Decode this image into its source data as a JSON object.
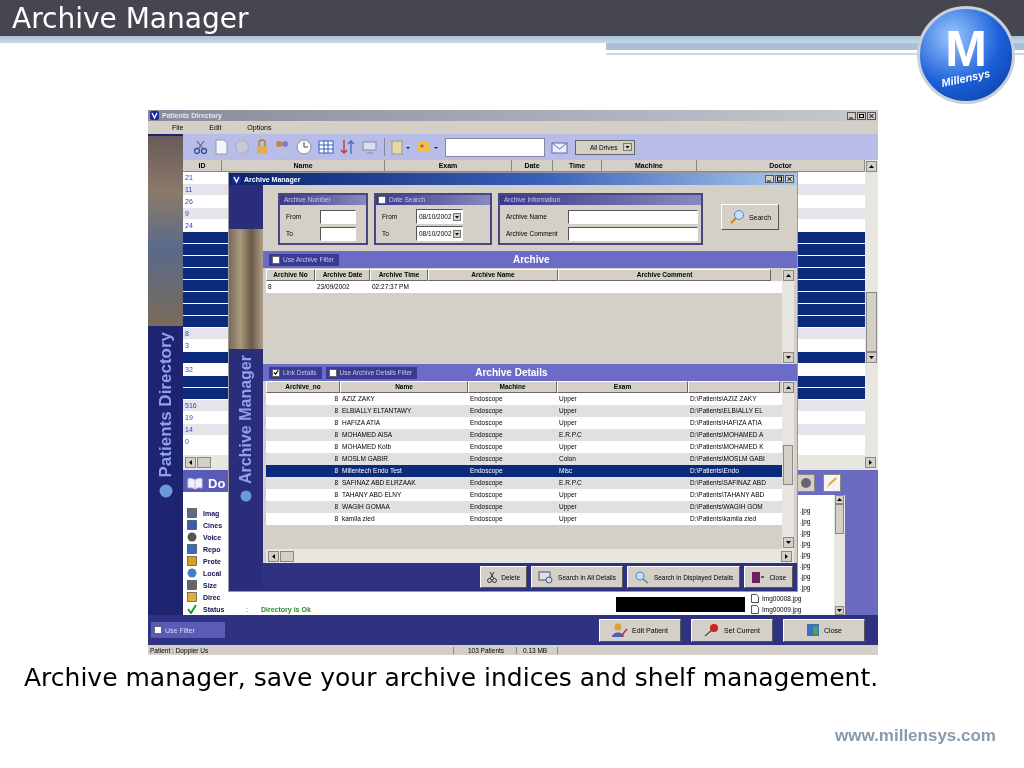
{
  "slide": {
    "title": "Archive Manager",
    "logo": {
      "letter": "M",
      "brand": "Millensys"
    },
    "caption": "Archive manager, save your archive indices and shelf management.",
    "footer": "www.millensys.com"
  },
  "patients_window": {
    "title": "Patients Directory",
    "menu": [
      "File",
      "Edit",
      "Options"
    ],
    "toolbar": {
      "drive": "All Drives"
    },
    "side_label": "Patients Directory",
    "table": {
      "columns": [
        "ID",
        "Name",
        "Exam",
        "Date",
        "Time",
        "Machine",
        "Doctor"
      ],
      "rows": [
        {
          "id": "21",
          "selected": false
        },
        {
          "id": "11",
          "selected": false
        },
        {
          "id": "26",
          "selected": false
        },
        {
          "id": "9",
          "selected": false
        },
        {
          "id": "24",
          "selected": false
        },
        {
          "selected": true
        },
        {
          "selected": true
        },
        {
          "selected": true
        },
        {
          "selected": true
        },
        {
          "selected": true
        },
        {
          "selected": true
        },
        {
          "selected": true
        },
        {
          "selected": true
        },
        {
          "id": "8",
          "selected": false
        },
        {
          "id": "3",
          "selected": false
        },
        {
          "selected": true
        },
        {
          "id": "32",
          "selected": false
        },
        {
          "selected": true
        },
        {
          "selected": true
        },
        {
          "id": "516",
          "selected": false
        },
        {
          "id": "19",
          "selected": false
        },
        {
          "id": "14",
          "selected": false
        },
        {
          "id": "0",
          "selected": false
        }
      ]
    },
    "details": {
      "heading": "Do",
      "items": [
        {
          "label": "Imag",
          "kind": "image"
        },
        {
          "label": "Cines",
          "kind": "cine"
        },
        {
          "label": "Voice",
          "kind": "voice"
        },
        {
          "label": "Repo",
          "kind": "report"
        },
        {
          "label": "Prote",
          "kind": "protect"
        },
        {
          "label": "Local",
          "kind": "local"
        },
        {
          "label": "Size",
          "kind": "size"
        },
        {
          "label": "Direc",
          "kind": "directory"
        }
      ],
      "status": {
        "label": "Status",
        "separator": ":",
        "value": "Directory is Ok"
      }
    },
    "files": [
      ".jpg",
      ".jpg",
      ".jpg",
      ".jpg",
      ".jpg",
      ".jpg",
      ".jpg",
      ".jpg",
      "Img00008.jpg",
      "Img00009.jpg"
    ],
    "use_filter": {
      "label": "Use Filter",
      "checked": false
    },
    "buttons": [
      {
        "label": "Edit Patient",
        "kind": "edit"
      },
      {
        "label": "Set Current",
        "kind": "pin"
      },
      {
        "label": "Close",
        "kind": "close"
      }
    ],
    "status_bar": [
      "Patient : Doppler Us",
      "103 Patients",
      "0.13 MB"
    ]
  },
  "archive_window": {
    "title": "Archive Manager",
    "side_label": "Archive Manager",
    "archive_number": {
      "legend": "Archive Number",
      "from_label": "From",
      "to_label": "To"
    },
    "date_search": {
      "legend": "Date Search",
      "checked": false,
      "from_label": "From",
      "from": "08/10/2002",
      "to_label": "To",
      "to": "08/10/2002"
    },
    "archive_information": {
      "legend": "Archive Information",
      "name_label": "Archive Name",
      "comment_label": "Archive Comment"
    },
    "search_button": "Search",
    "archive": {
      "heading": "Archive",
      "filter": {
        "label": "Use Archive Filter",
        "checked": false
      },
      "columns": [
        "Archive No",
        "Archive Date",
        "Archive Time",
        "Archive Name",
        "Archive Comment"
      ],
      "rows": [
        {
          "cells": [
            "8",
            "23/09/2002",
            "02:27:37 PM"
          ],
          "selected": false
        }
      ]
    },
    "details": {
      "heading": "Archive Details",
      "link_details": {
        "label": "Link Details",
        "checked": true
      },
      "filter": {
        "label": "Use Archive Details Filter",
        "checked": false
      },
      "columns": [
        "Archive_no",
        "Name",
        "Machine",
        "Exam"
      ],
      "rows": [
        {
          "archive_no": "8",
          "name": "AZIZ ZAKY",
          "machine": "Endoscope",
          "exam": "Upper",
          "path": "D:\\Patients\\AZIZ ZAKY",
          "selected": false
        },
        {
          "archive_no": "8",
          "name": "ELBIALLY ELTANTAWY",
          "machine": "Endoscope",
          "exam": "Upper",
          "path": "D:\\Patients\\ELBIALLY EL",
          "selected": false
        },
        {
          "archive_no": "8",
          "name": "HAFIZA ATIA",
          "machine": "Endoscope",
          "exam": "Upper",
          "path": "D:\\Patients\\HAFIZA ATIA",
          "selected": false
        },
        {
          "archive_no": "8",
          "name": "MOHAMED  AISA",
          "machine": "Endoscope",
          "exam": "E.R.P.C",
          "path": "D:\\Patients\\MOHAMED  A",
          "selected": false
        },
        {
          "archive_no": "8",
          "name": "MOHAMED Kotb",
          "machine": "Endoscope",
          "exam": "Upper",
          "path": "D:\\Patients\\MOHAMED K",
          "selected": false
        },
        {
          "archive_no": "8",
          "name": "MOSLM GABIR",
          "machine": "Endoscope",
          "exam": "Colon",
          "path": "D:\\Patients\\MOSLM GABI",
          "selected": false
        },
        {
          "archive_no": "8",
          "name": "Millentech Endo Test",
          "machine": "Endoscope",
          "exam": "Misc",
          "path": "D:\\Patients\\Endo",
          "selected": true
        },
        {
          "archive_no": "8",
          "name": "SAFINAZ ABD ELRZAAK",
          "machine": "Endoscope",
          "exam": "E.R.P.C",
          "path": "D:\\Patients\\SAFINAZ ABD",
          "selected": false
        },
        {
          "archive_no": "8",
          "name": "TAHANY ABD ELNY",
          "machine": "Endoscope",
          "exam": "Upper",
          "path": "D:\\Patients\\TAHANY ABD",
          "selected": false
        },
        {
          "archive_no": "8",
          "name": "WAGIH GOMAA",
          "machine": "Endoscope",
          "exam": "Upper",
          "path": "D:\\Patients\\WAGIH GOM",
          "selected": false
        },
        {
          "archive_no": "8",
          "name": "kamila zied",
          "machine": "Endoscope",
          "exam": "Upper",
          "path": "D:\\Patients\\kamila zied",
          "selected": false
        }
      ]
    },
    "buttons": [
      {
        "label": "Delete",
        "kind": "delete"
      },
      {
        "label": "Search in All Details",
        "kind": "search_all"
      },
      {
        "label": "Search in Displayed Details",
        "kind": "search"
      },
      {
        "label": "Close",
        "kind": "close"
      }
    ]
  }
}
